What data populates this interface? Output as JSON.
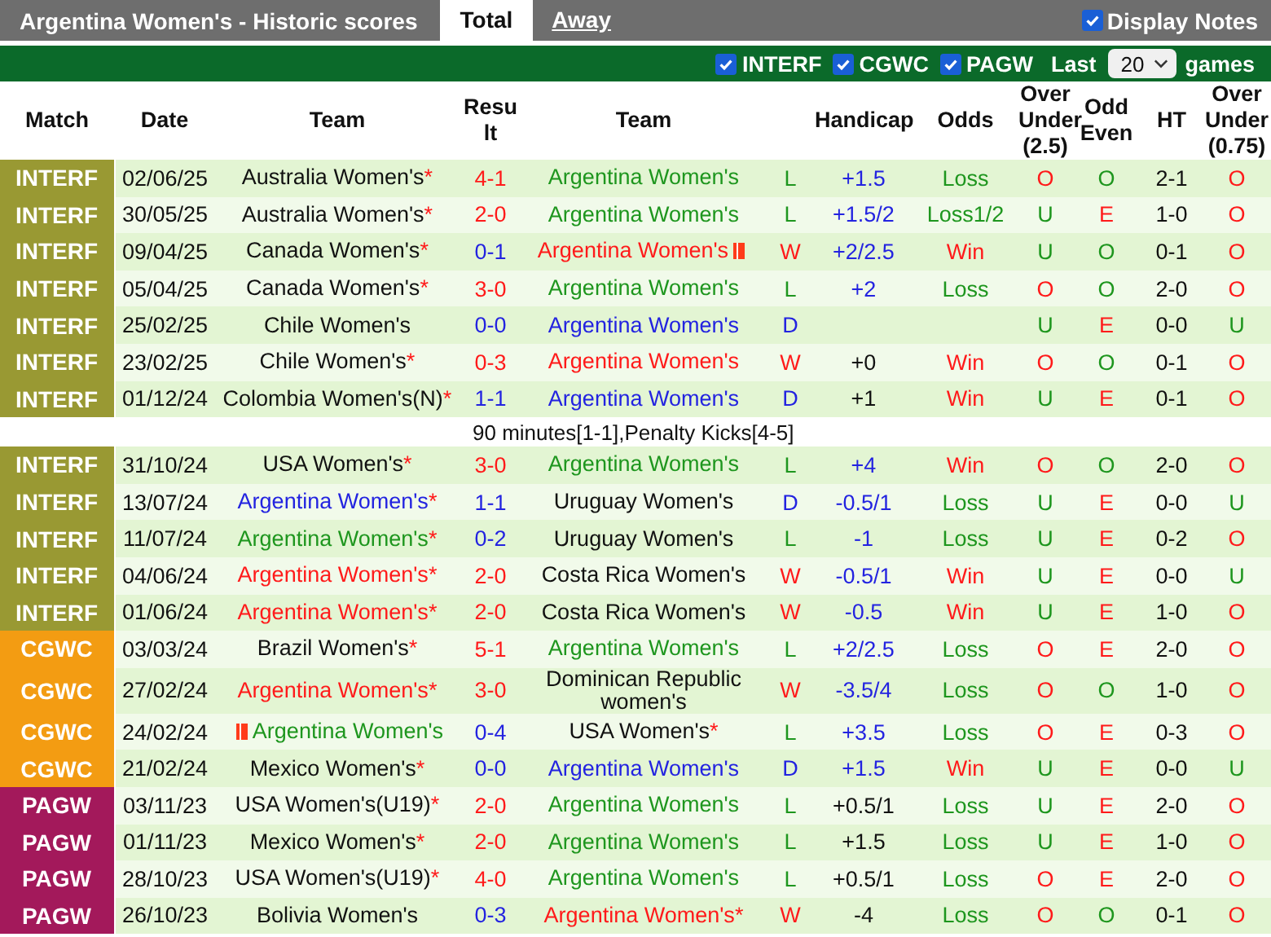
{
  "title": "Argentina Women's - Historic scores",
  "tabs": [
    {
      "label": "Total",
      "selected": true
    },
    {
      "label": "Away",
      "selected": false
    }
  ],
  "display_notes": {
    "label": "Display Notes",
    "checked": true
  },
  "filters": [
    {
      "label": "INTERF",
      "checked": true
    },
    {
      "label": "CGWC",
      "checked": true
    },
    {
      "label": "PAGW",
      "checked": true
    }
  ],
  "last": {
    "label": "Last",
    "value": "20",
    "suffix": "games"
  },
  "columns": [
    "Match",
    "Date",
    "Team",
    "Result",
    "Team",
    "",
    "Handicap",
    "Odds",
    "Over Under (2.5)",
    "Odd Even",
    "HT",
    "Over Under (0.75)"
  ],
  "rows": [
    {
      "kind": "match",
      "league": "INTERF",
      "color": "#999933",
      "date": "02/06/25",
      "home": {
        "text": "Australia Women's",
        "color": "#111111",
        "mark": "*"
      },
      "score": {
        "text": "4-1",
        "color": "#ff1a1a"
      },
      "away": {
        "text": "Argentina Women's",
        "color": "#1e961e"
      },
      "result": {
        "text": "L",
        "color": "#1e961e"
      },
      "handicap": {
        "text": "+1.5",
        "color": "#2323e0"
      },
      "odds": {
        "text": "Loss",
        "color": "#1e961e"
      },
      "over_under": {
        "text": "O",
        "color": "#ff1a1a"
      },
      "odd_even": {
        "text": "O",
        "color": "#1e961e"
      },
      "ht": "2-1",
      "over_under_075": {
        "text": "O",
        "color": "#ff1a1a"
      }
    },
    {
      "kind": "match",
      "league": "INTERF",
      "color": "#999933",
      "date": "30/05/25",
      "home": {
        "text": "Australia Women's",
        "color": "#111111",
        "mark": "*"
      },
      "score": {
        "text": "2-0",
        "color": "#ff1a1a"
      },
      "away": {
        "text": "Argentina Women's",
        "color": "#1e961e"
      },
      "result": {
        "text": "L",
        "color": "#1e961e"
      },
      "handicap": {
        "text": "+1.5/2",
        "color": "#2323e0"
      },
      "odds": {
        "text": "Loss1/2",
        "color": "#1e961e"
      },
      "over_under": {
        "text": "U",
        "color": "#1e961e"
      },
      "odd_even": {
        "text": "E",
        "color": "#ff1a1a"
      },
      "ht": "1-0",
      "over_under_075": {
        "text": "O",
        "color": "#ff1a1a"
      }
    },
    {
      "kind": "match",
      "league": "INTERF",
      "color": "#999933",
      "date": "09/04/25",
      "home": {
        "text": "Canada Women's",
        "color": "#111111",
        "mark": "*"
      },
      "score": {
        "text": "0-1",
        "color": "#2323e0"
      },
      "away": {
        "text": "Argentina Women's",
        "color": "#ff1a1a",
        "card": true
      },
      "result": {
        "text": "W",
        "color": "#ff1a1a"
      },
      "handicap": {
        "text": "+2/2.5",
        "color": "#2323e0"
      },
      "odds": {
        "text": "Win",
        "color": "#ff1a1a"
      },
      "over_under": {
        "text": "U",
        "color": "#1e961e"
      },
      "odd_even": {
        "text": "O",
        "color": "#1e961e"
      },
      "ht": "0-1",
      "over_under_075": {
        "text": "O",
        "color": "#ff1a1a"
      }
    },
    {
      "kind": "match",
      "league": "INTERF",
      "color": "#999933",
      "date": "05/04/25",
      "home": {
        "text": "Canada Women's",
        "color": "#111111",
        "mark": "*"
      },
      "score": {
        "text": "3-0",
        "color": "#ff1a1a"
      },
      "away": {
        "text": "Argentina Women's",
        "color": "#1e961e"
      },
      "result": {
        "text": "L",
        "color": "#1e961e"
      },
      "handicap": {
        "text": "+2",
        "color": "#2323e0"
      },
      "odds": {
        "text": "Loss",
        "color": "#1e961e"
      },
      "over_under": {
        "text": "O",
        "color": "#ff1a1a"
      },
      "odd_even": {
        "text": "O",
        "color": "#1e961e"
      },
      "ht": "2-0",
      "over_under_075": {
        "text": "O",
        "color": "#ff1a1a"
      }
    },
    {
      "kind": "match",
      "league": "INTERF",
      "color": "#999933",
      "date": "25/02/25",
      "home": {
        "text": "Chile Women's",
        "color": "#111111"
      },
      "score": {
        "text": "0-0",
        "color": "#2323e0"
      },
      "away": {
        "text": "Argentina Women's",
        "color": "#2323e0"
      },
      "result": {
        "text": "D",
        "color": "#2323e0"
      },
      "over_under": {
        "text": "U",
        "color": "#1e961e"
      },
      "odd_even": {
        "text": "E",
        "color": "#ff1a1a"
      },
      "ht": "0-0",
      "over_under_075": {
        "text": "U",
        "color": "#1e961e"
      }
    },
    {
      "kind": "match",
      "league": "INTERF",
      "color": "#999933",
      "date": "23/02/25",
      "home": {
        "text": "Chile Women's",
        "color": "#111111",
        "mark": "*"
      },
      "score": {
        "text": "0-3",
        "color": "#ff1a1a"
      },
      "away": {
        "text": "Argentina Women's",
        "color": "#ff1a1a"
      },
      "result": {
        "text": "W",
        "color": "#ff1a1a"
      },
      "handicap": {
        "text": "+0",
        "color": "#111111"
      },
      "odds": {
        "text": "Win",
        "color": "#ff1a1a"
      },
      "over_under": {
        "text": "O",
        "color": "#ff1a1a"
      },
      "odd_even": {
        "text": "O",
        "color": "#1e961e"
      },
      "ht": "0-1",
      "over_under_075": {
        "text": "O",
        "color": "#ff1a1a"
      }
    },
    {
      "kind": "match",
      "league": "INTERF",
      "color": "#999933",
      "date": "01/12/24",
      "home": {
        "text": "Colombia Women's(N)",
        "color": "#111111",
        "mark": "*"
      },
      "score": {
        "text": "1-1",
        "color": "#2323e0"
      },
      "away": {
        "text": "Argentina Women's",
        "color": "#2323e0"
      },
      "result": {
        "text": "D",
        "color": "#2323e0"
      },
      "handicap": {
        "text": "+1",
        "color": "#111111"
      },
      "odds": {
        "text": "Win",
        "color": "#ff1a1a"
      },
      "over_under": {
        "text": "U",
        "color": "#1e961e"
      },
      "odd_even": {
        "text": "E",
        "color": "#ff1a1a"
      },
      "ht": "0-1",
      "over_under_075": {
        "text": "O",
        "color": "#ff1a1a"
      }
    },
    {
      "kind": "note",
      "text": "90 minutes[1-1],Penalty Kicks[4-5]"
    },
    {
      "kind": "match",
      "league": "INTERF",
      "color": "#999933",
      "date": "31/10/24",
      "home": {
        "text": "USA Women's",
        "color": "#111111",
        "mark": "*"
      },
      "score": {
        "text": "3-0",
        "color": "#ff1a1a"
      },
      "away": {
        "text": "Argentina Women's",
        "color": "#1e961e"
      },
      "result": {
        "text": "L",
        "color": "#1e961e"
      },
      "handicap": {
        "text": "+4",
        "color": "#2323e0"
      },
      "odds": {
        "text": "Win",
        "color": "#ff1a1a"
      },
      "over_under": {
        "text": "O",
        "color": "#ff1a1a"
      },
      "odd_even": {
        "text": "O",
        "color": "#1e961e"
      },
      "ht": "2-0",
      "over_under_075": {
        "text": "O",
        "color": "#ff1a1a"
      }
    },
    {
      "kind": "match",
      "league": "INTERF",
      "color": "#999933",
      "date": "13/07/24",
      "home": {
        "text": "Argentina Women's",
        "color": "#2323e0",
        "mark": "*"
      },
      "score": {
        "text": "1-1",
        "color": "#2323e0"
      },
      "away": {
        "text": "Uruguay Women's",
        "color": "#111111"
      },
      "result": {
        "text": "D",
        "color": "#2323e0"
      },
      "handicap": {
        "text": "-0.5/1",
        "color": "#2323e0"
      },
      "odds": {
        "text": "Loss",
        "color": "#1e961e"
      },
      "over_under": {
        "text": "U",
        "color": "#1e961e"
      },
      "odd_even": {
        "text": "E",
        "color": "#ff1a1a"
      },
      "ht": "0-0",
      "over_under_075": {
        "text": "U",
        "color": "#1e961e"
      }
    },
    {
      "kind": "match",
      "league": "INTERF",
      "color": "#999933",
      "date": "11/07/24",
      "home": {
        "text": "Argentina Women's",
        "color": "#1e961e",
        "mark": "*"
      },
      "score": {
        "text": "0-2",
        "color": "#2323e0"
      },
      "away": {
        "text": "Uruguay Women's",
        "color": "#111111"
      },
      "result": {
        "text": "L",
        "color": "#1e961e"
      },
      "handicap": {
        "text": "-1",
        "color": "#2323e0"
      },
      "odds": {
        "text": "Loss",
        "color": "#1e961e"
      },
      "over_under": {
        "text": "U",
        "color": "#1e961e"
      },
      "odd_even": {
        "text": "E",
        "color": "#ff1a1a"
      },
      "ht": "0-2",
      "over_under_075": {
        "text": "O",
        "color": "#ff1a1a"
      }
    },
    {
      "kind": "match",
      "league": "INTERF",
      "color": "#999933",
      "date": "04/06/24",
      "home": {
        "text": "Argentina Women's",
        "color": "#ff1a1a",
        "mark": "*"
      },
      "score": {
        "text": "2-0",
        "color": "#ff1a1a"
      },
      "away": {
        "text": "Costa Rica Women's",
        "color": "#111111"
      },
      "result": {
        "text": "W",
        "color": "#ff1a1a"
      },
      "handicap": {
        "text": "-0.5/1",
        "color": "#2323e0"
      },
      "odds": {
        "text": "Win",
        "color": "#ff1a1a"
      },
      "over_under": {
        "text": "U",
        "color": "#1e961e"
      },
      "odd_even": {
        "text": "E",
        "color": "#ff1a1a"
      },
      "ht": "0-0",
      "over_under_075": {
        "text": "U",
        "color": "#1e961e"
      }
    },
    {
      "kind": "match",
      "league": "INTERF",
      "color": "#999933",
      "date": "01/06/24",
      "home": {
        "text": "Argentina Women's",
        "color": "#ff1a1a",
        "mark": "*"
      },
      "score": {
        "text": "2-0",
        "color": "#ff1a1a"
      },
      "away": {
        "text": "Costa Rica Women's",
        "color": "#111111"
      },
      "result": {
        "text": "W",
        "color": "#ff1a1a"
      },
      "handicap": {
        "text": "-0.5",
        "color": "#2323e0"
      },
      "odds": {
        "text": "Win",
        "color": "#ff1a1a"
      },
      "over_under": {
        "text": "U",
        "color": "#1e961e"
      },
      "odd_even": {
        "text": "E",
        "color": "#ff1a1a"
      },
      "ht": "1-0",
      "over_under_075": {
        "text": "O",
        "color": "#ff1a1a"
      }
    },
    {
      "kind": "match",
      "league": "CGWC",
      "color": "#f39c12",
      "date": "03/03/24",
      "home": {
        "text": "Brazil Women's",
        "color": "#111111",
        "mark": "*"
      },
      "score": {
        "text": "5-1",
        "color": "#ff1a1a"
      },
      "away": {
        "text": "Argentina Women's",
        "color": "#1e961e"
      },
      "result": {
        "text": "L",
        "color": "#1e961e"
      },
      "handicap": {
        "text": "+2/2.5",
        "color": "#2323e0"
      },
      "odds": {
        "text": "Loss",
        "color": "#1e961e"
      },
      "over_under": {
        "text": "O",
        "color": "#ff1a1a"
      },
      "odd_even": {
        "text": "E",
        "color": "#ff1a1a"
      },
      "ht": "2-0",
      "over_under_075": {
        "text": "O",
        "color": "#ff1a1a"
      }
    },
    {
      "kind": "match",
      "league": "CGWC",
      "color": "#f39c12",
      "date": "27/02/24",
      "home": {
        "text": "Argentina Women's",
        "color": "#ff1a1a",
        "mark": "*"
      },
      "score": {
        "text": "3-0",
        "color": "#ff1a1a"
      },
      "away": {
        "text": "Dominican Republic women's",
        "color": "#111111"
      },
      "result": {
        "text": "W",
        "color": "#ff1a1a"
      },
      "handicap": {
        "text": "-3.5/4",
        "color": "#2323e0"
      },
      "odds": {
        "text": "Loss",
        "color": "#1e961e"
      },
      "over_under": {
        "text": "O",
        "color": "#ff1a1a"
      },
      "odd_even": {
        "text": "O",
        "color": "#1e961e"
      },
      "ht": "1-0",
      "over_under_075": {
        "text": "O",
        "color": "#ff1a1a"
      }
    },
    {
      "kind": "match",
      "league": "CGWC",
      "color": "#f39c12",
      "date": "24/02/24",
      "home": {
        "text": "Argentina Women's",
        "color": "#1e961e",
        "card": true
      },
      "score": {
        "text": "0-4",
        "color": "#2323e0"
      },
      "away": {
        "text": "USA Women's",
        "color": "#111111",
        "mark": "*"
      },
      "result": {
        "text": "L",
        "color": "#1e961e"
      },
      "handicap": {
        "text": "+3.5",
        "color": "#2323e0"
      },
      "odds": {
        "text": "Loss",
        "color": "#1e961e"
      },
      "over_under": {
        "text": "O",
        "color": "#ff1a1a"
      },
      "odd_even": {
        "text": "E",
        "color": "#ff1a1a"
      },
      "ht": "0-3",
      "over_under_075": {
        "text": "O",
        "color": "#ff1a1a"
      }
    },
    {
      "kind": "match",
      "league": "CGWC",
      "color": "#f39c12",
      "date": "21/02/24",
      "home": {
        "text": "Mexico Women's",
        "color": "#111111",
        "mark": "*"
      },
      "score": {
        "text": "0-0",
        "color": "#2323e0"
      },
      "away": {
        "text": "Argentina Women's",
        "color": "#2323e0"
      },
      "result": {
        "text": "D",
        "color": "#2323e0"
      },
      "handicap": {
        "text": "+1.5",
        "color": "#2323e0"
      },
      "odds": {
        "text": "Win",
        "color": "#ff1a1a"
      },
      "over_under": {
        "text": "U",
        "color": "#1e961e"
      },
      "odd_even": {
        "text": "E",
        "color": "#ff1a1a"
      },
      "ht": "0-0",
      "over_under_075": {
        "text": "U",
        "color": "#1e961e"
      }
    },
    {
      "kind": "match",
      "league": "PAGW",
      "color": "#a3195b",
      "date": "03/11/23",
      "home": {
        "text": "USA Women's(U19)",
        "color": "#111111",
        "mark": "*"
      },
      "score": {
        "text": "2-0",
        "color": "#ff1a1a"
      },
      "away": {
        "text": "Argentina Women's",
        "color": "#1e961e"
      },
      "result": {
        "text": "L",
        "color": "#1e961e"
      },
      "handicap": {
        "text": "+0.5/1",
        "color": "#111111"
      },
      "odds": {
        "text": "Loss",
        "color": "#1e961e"
      },
      "over_under": {
        "text": "U",
        "color": "#1e961e"
      },
      "odd_even": {
        "text": "E",
        "color": "#ff1a1a"
      },
      "ht": "2-0",
      "over_under_075": {
        "text": "O",
        "color": "#ff1a1a"
      }
    },
    {
      "kind": "match",
      "league": "PAGW",
      "color": "#a3195b",
      "date": "01/11/23",
      "home": {
        "text": "Mexico Women's",
        "color": "#111111",
        "mark": "*"
      },
      "score": {
        "text": "2-0",
        "color": "#ff1a1a"
      },
      "away": {
        "text": "Argentina Women's",
        "color": "#1e961e"
      },
      "result": {
        "text": "L",
        "color": "#1e961e"
      },
      "handicap": {
        "text": "+1.5",
        "color": "#111111"
      },
      "odds": {
        "text": "Loss",
        "color": "#1e961e"
      },
      "over_under": {
        "text": "U",
        "color": "#1e961e"
      },
      "odd_even": {
        "text": "E",
        "color": "#ff1a1a"
      },
      "ht": "1-0",
      "over_under_075": {
        "text": "O",
        "color": "#ff1a1a"
      }
    },
    {
      "kind": "match",
      "league": "PAGW",
      "color": "#a3195b",
      "date": "28/10/23",
      "home": {
        "text": "USA Women's(U19)",
        "color": "#111111",
        "mark": "*"
      },
      "score": {
        "text": "4-0",
        "color": "#ff1a1a"
      },
      "away": {
        "text": "Argentina Women's",
        "color": "#1e961e"
      },
      "result": {
        "text": "L",
        "color": "#1e961e"
      },
      "handicap": {
        "text": "+0.5/1",
        "color": "#111111"
      },
      "odds": {
        "text": "Loss",
        "color": "#1e961e"
      },
      "over_under": {
        "text": "O",
        "color": "#ff1a1a"
      },
      "odd_even": {
        "text": "E",
        "color": "#ff1a1a"
      },
      "ht": "2-0",
      "over_under_075": {
        "text": "O",
        "color": "#ff1a1a"
      }
    },
    {
      "kind": "match",
      "league": "PAGW",
      "color": "#a3195b",
      "date": "26/10/23",
      "home": {
        "text": "Bolivia Women's",
        "color": "#111111"
      },
      "score": {
        "text": "0-3",
        "color": "#2323e0"
      },
      "away": {
        "text": "Argentina Women's",
        "color": "#ff1a1a",
        "mark": "*"
      },
      "result": {
        "text": "W",
        "color": "#ff1a1a"
      },
      "handicap": {
        "text": "-4",
        "color": "#111111"
      },
      "odds": {
        "text": "Loss",
        "color": "#1e961e"
      },
      "over_under": {
        "text": "O",
        "color": "#ff1a1a"
      },
      "odd_even": {
        "text": "O",
        "color": "#1e961e"
      },
      "ht": "0-1",
      "over_under_075": {
        "text": "O",
        "color": "#ff1a1a"
      }
    }
  ]
}
